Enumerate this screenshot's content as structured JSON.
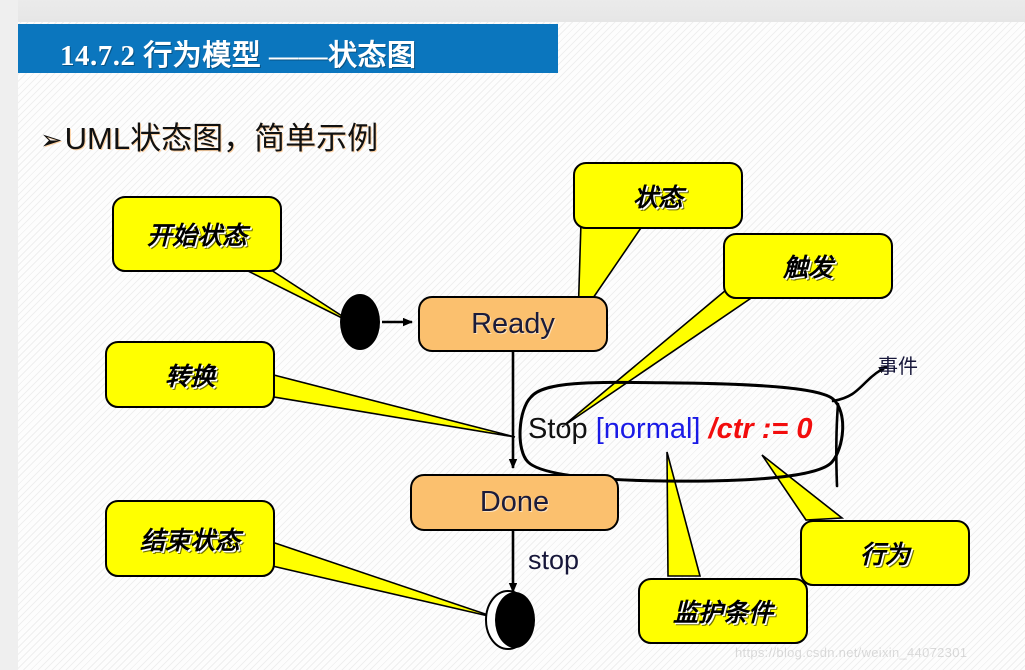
{
  "slide": {
    "title": "14.7.2 行为模型 ——状态图",
    "subtitle": "UML状态图，简单示例",
    "bullet_glyph": "➢",
    "watermark": "https://blog.csdn.net/weixin_44072301"
  },
  "colors": {
    "title_bar": "#0b76be",
    "state_fill": "#fbc06e",
    "callout_fill": "#ffff00",
    "guard_text": "#1a1ae6",
    "action_text": "#f20d0d",
    "initial_state": "#000000"
  },
  "diagram": {
    "states": [
      {
        "id": "ready",
        "label": "Ready",
        "shape": "rounded-rect"
      },
      {
        "id": "done",
        "label": "Done",
        "shape": "rounded-rect"
      }
    ],
    "pseudostates": [
      {
        "id": "initial",
        "kind": "initial",
        "shape": "filled-ellipse"
      },
      {
        "id": "final",
        "kind": "final",
        "shape": "double-ellipse"
      }
    ],
    "transitions": [
      {
        "from": "initial",
        "to": "ready",
        "label": ""
      },
      {
        "from": "ready",
        "to": "done",
        "event": "Stop",
        "guard": "[normal]",
        "action": "/ctr := 0",
        "label_full": "Stop [normal] /ctr := 0"
      },
      {
        "from": "done",
        "to": "final",
        "label": "stop"
      }
    ],
    "annotations": [
      {
        "id": "event-pointer",
        "label": "事件"
      }
    ]
  },
  "callouts": [
    {
      "id": "start",
      "label": "开始状态",
      "points_to": "initial"
    },
    {
      "id": "trans",
      "label": "转换",
      "points_to": "ready-done-transition"
    },
    {
      "id": "end",
      "label": "结束状态",
      "points_to": "final"
    },
    {
      "id": "state",
      "label": "状态",
      "points_to": "ready"
    },
    {
      "id": "trigger",
      "label": "触发",
      "points_to": "event-Stop"
    },
    {
      "id": "guard",
      "label": "监护条件",
      "points_to": "guard-normal"
    },
    {
      "id": "action",
      "label": "行为",
      "points_to": "action-ctr"
    }
  ]
}
